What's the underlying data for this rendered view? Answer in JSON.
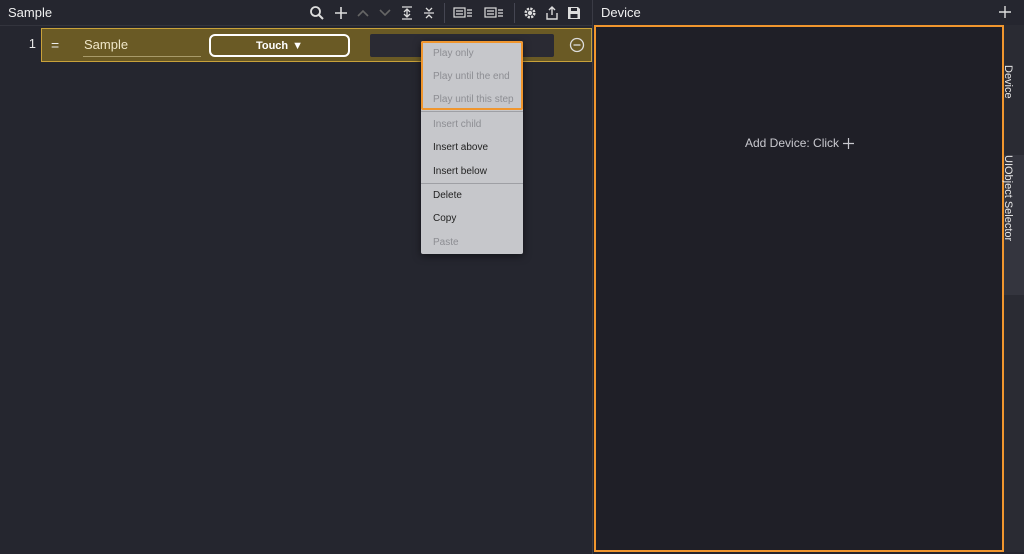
{
  "scenario": {
    "title": "Sample"
  },
  "toolbar": {
    "icons": [
      "search-icon",
      "plus-icon",
      "chevron-up-icon",
      "chevron-down-icon",
      "expand-icon",
      "collapse-icon",
      "record-list-icon",
      "record-list-settings-icon",
      "gear-icon",
      "export-icon",
      "save-icon"
    ]
  },
  "step": {
    "index": "1",
    "handle": "=",
    "name": "Sample",
    "action": "Touch",
    "action_arrow": "▼"
  },
  "context_menu": {
    "items": [
      {
        "label": "Play only",
        "enabled": false
      },
      {
        "label": "Play until the end",
        "enabled": false
      },
      {
        "label": "Play until this step",
        "enabled": false
      },
      {
        "label": "Insert child",
        "enabled": false
      },
      {
        "label": "Insert above",
        "enabled": true
      },
      {
        "label": "Insert below",
        "enabled": true
      },
      {
        "label": "Delete",
        "enabled": true
      },
      {
        "label": "Copy",
        "enabled": true
      },
      {
        "label": "Paste",
        "enabled": false
      }
    ]
  },
  "device_panel": {
    "title": "Device",
    "hint": "Add Device: Click"
  },
  "side_tabs": {
    "device": "Device",
    "ui_object_selector": "UIObject Selector"
  },
  "colors": {
    "accent": "#f0962e",
    "selected_row": "#6a5a25",
    "background": "#25262f"
  }
}
